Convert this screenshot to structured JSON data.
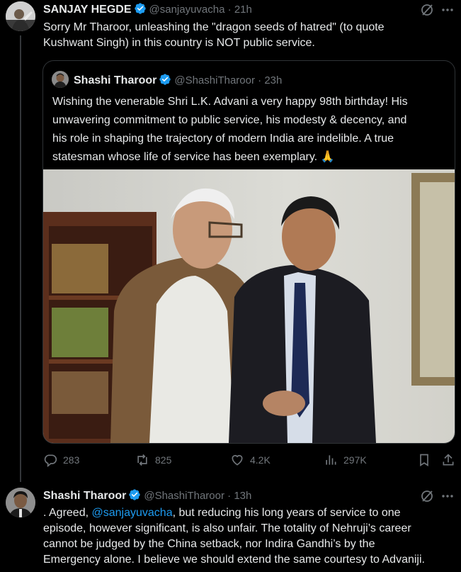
{
  "tweet1": {
    "name": "SANJAY HEGDE",
    "handle": "@sanjayuvacha",
    "time": "21h",
    "text_line1": "Sorry Mr Tharoor, unleashing the \"dragon seeds of hatred\" (to quote",
    "text_line2": "Kushwant Singh)  in this country is NOT public service.",
    "quote": {
      "name": "Shashi Tharoor",
      "handle": "@ShashiTharoor",
      "time": "23h",
      "lines": [
        "Wishing the venerable Shri L.K. Advani a very happy 98th birthday! His",
        "unwavering commitment to public service, his modesty & decency, and",
        "his role in shaping the trajectory of modern India are indelible. A true",
        "statesman whose life of service has been exemplary. 🙏"
      ]
    },
    "actions": {
      "replies": "283",
      "reposts": "825",
      "likes": "4.2K",
      "views": "297K"
    }
  },
  "tweet2": {
    "name": "Shashi Tharoor",
    "handle": "@ShashiTharoor",
    "time": "13h",
    "line1_prefix": ". Agreed, ",
    "mention": "@sanjayuvacha",
    "line1_suffix": ", but reducing his long years of service to one",
    "line2": "episode, however significant, is also unfair. The totality of Nehruji’s career",
    "line3": "cannot be judged by the China setback, nor Indira Gandhi’s by the",
    "line4": "Emergency alone. I believe we should extend the same courtesy to Advaniji."
  },
  "colors": {
    "background": "#000000",
    "text": "#e7e9ea",
    "muted": "#71767b",
    "verified": "#1d9bf0",
    "link": "#1d9bf0",
    "border": "#2f3336"
  }
}
